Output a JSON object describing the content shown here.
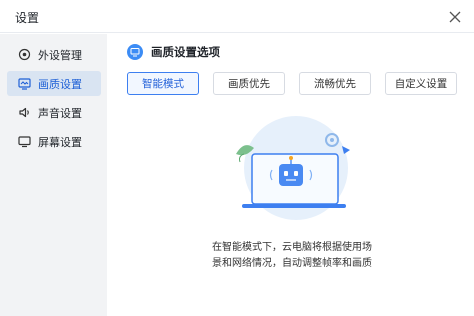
{
  "window": {
    "title": "设置"
  },
  "sidebar": {
    "items": [
      {
        "label": "外设管理",
        "icon": "gamepad-icon",
        "active": false
      },
      {
        "label": "画质设置",
        "icon": "monitor-image-icon",
        "active": true
      },
      {
        "label": "声音设置",
        "icon": "speaker-icon",
        "active": false
      },
      {
        "label": "屏幕设置",
        "icon": "screen-icon",
        "active": false
      }
    ]
  },
  "main": {
    "section_title": "画质设置选项",
    "options": [
      {
        "label": "智能模式",
        "selected": true
      },
      {
        "label": "画质优先",
        "selected": false
      },
      {
        "label": "流畅优先",
        "selected": false
      },
      {
        "label": "自定义设置",
        "selected": false
      }
    ],
    "description_line1": "在智能模式下，云电脑将根据使用场",
    "description_line2": "景和网络情况，自动调整帧率和画质"
  },
  "colors": {
    "accent": "#3d7ff0",
    "sidebar_bg": "#f2f3f5",
    "active_nav_bg": "#d9e4f2"
  }
}
